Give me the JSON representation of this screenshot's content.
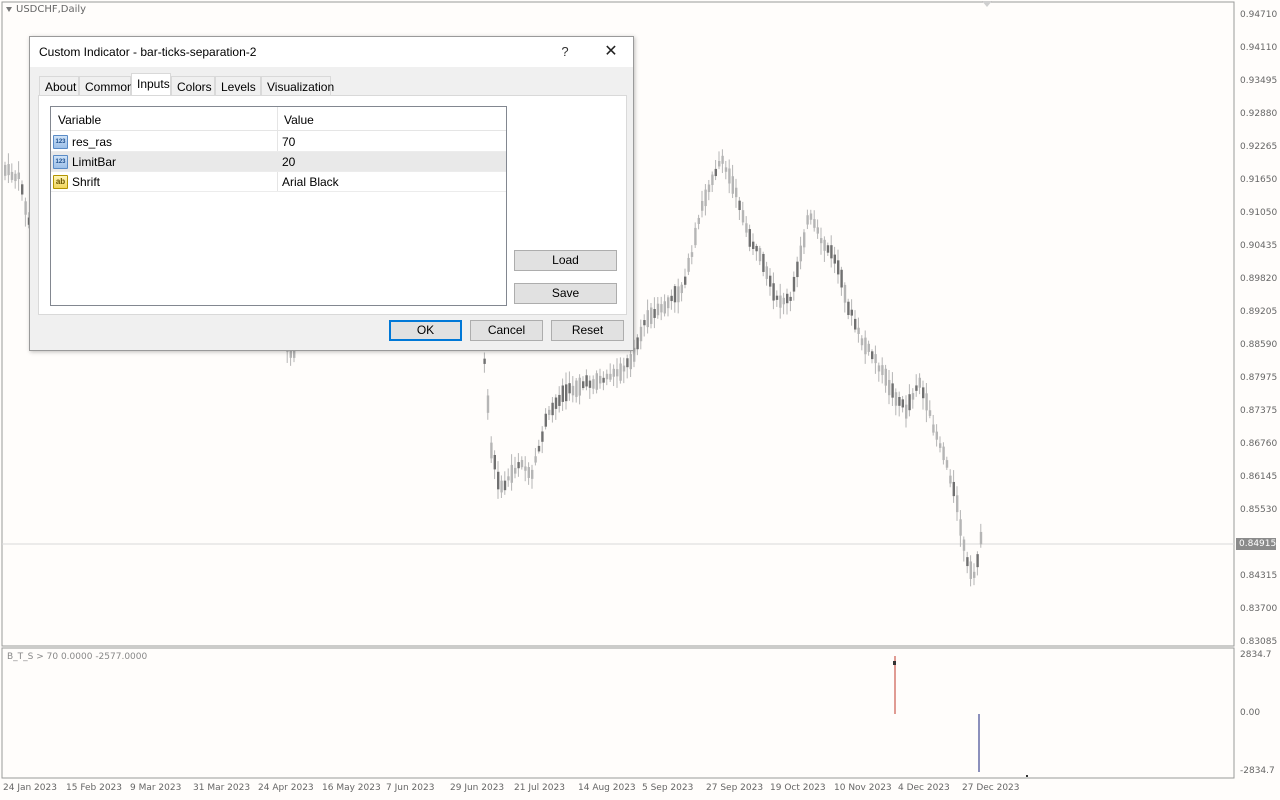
{
  "chart": {
    "symbol": "USDCHF,Daily",
    "indicator_label": "B_T_S > 70   0.0000 -2577.0000",
    "price_axis": [
      "0.94710",
      "0.94110",
      "0.93495",
      "0.92880",
      "0.92265",
      "0.91650",
      "0.91050",
      "0.90435",
      "0.89820",
      "0.89205",
      "0.88590",
      "0.87975",
      "0.87375",
      "0.86760",
      "0.86145",
      "0.85530",
      "0.84315",
      "0.83700",
      "0.83085"
    ],
    "current_price": "0.84915",
    "indicator_axis": [
      "2834.7",
      "0.00",
      "-2834.7"
    ],
    "date_axis": [
      "24 Jan 2023",
      "15 Feb 2023",
      "9 Mar 2023",
      "31 Mar 2023",
      "24 Apr 2023",
      "16 May 2023",
      "7 Jun 2023",
      "29 Jun 2023",
      "21 Jul 2023",
      "14 Aug 2023",
      "5 Sep 2023",
      "27 Sep 2023",
      "19 Oct 2023",
      "10 Nov 2023",
      "4 Dec 2023",
      "27 Dec 2023"
    ],
    "colors": {
      "candle": "#b5b5b5",
      "candle_dark": "#707070",
      "grid_line": "#d6d6d6",
      "indicator_up": "#c0392b",
      "indicator_down": "#1a237e"
    }
  },
  "dialog": {
    "title": "Custom Indicator - bar-ticks-separation-2",
    "help_label": "?",
    "close_label": "✕",
    "tabs": [
      "About",
      "Common",
      "Inputs",
      "Colors",
      "Levels",
      "Visualization"
    ],
    "active_tab": "Inputs",
    "table": {
      "headers": [
        "Variable",
        "Value"
      ],
      "rows": [
        {
          "type_icon": "123",
          "variable": "res_ras",
          "value": "70"
        },
        {
          "type_icon": "123",
          "variable": "LimitBar",
          "value": "20"
        },
        {
          "type_icon": "ab",
          "variable": "Shrift",
          "value": "Arial Black"
        }
      ]
    },
    "load_label": "Load",
    "save_label": "Save",
    "ok_label": "OK",
    "cancel_label": "Cancel",
    "reset_label": "Reset"
  }
}
